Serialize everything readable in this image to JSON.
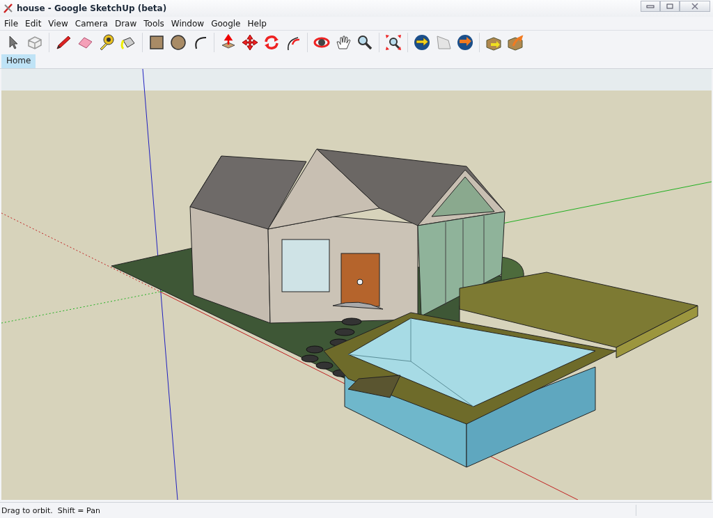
{
  "window": {
    "title": "house - Google SketchUp (beta)"
  },
  "menu": [
    "File",
    "Edit",
    "View",
    "Camera",
    "Draw",
    "Tools",
    "Window",
    "Google",
    "Help"
  ],
  "scene_tabs": [
    {
      "label": "Home",
      "selected": true
    }
  ],
  "status_bar": {
    "text": "Drag to orbit.  Shift = Pan"
  }
}
